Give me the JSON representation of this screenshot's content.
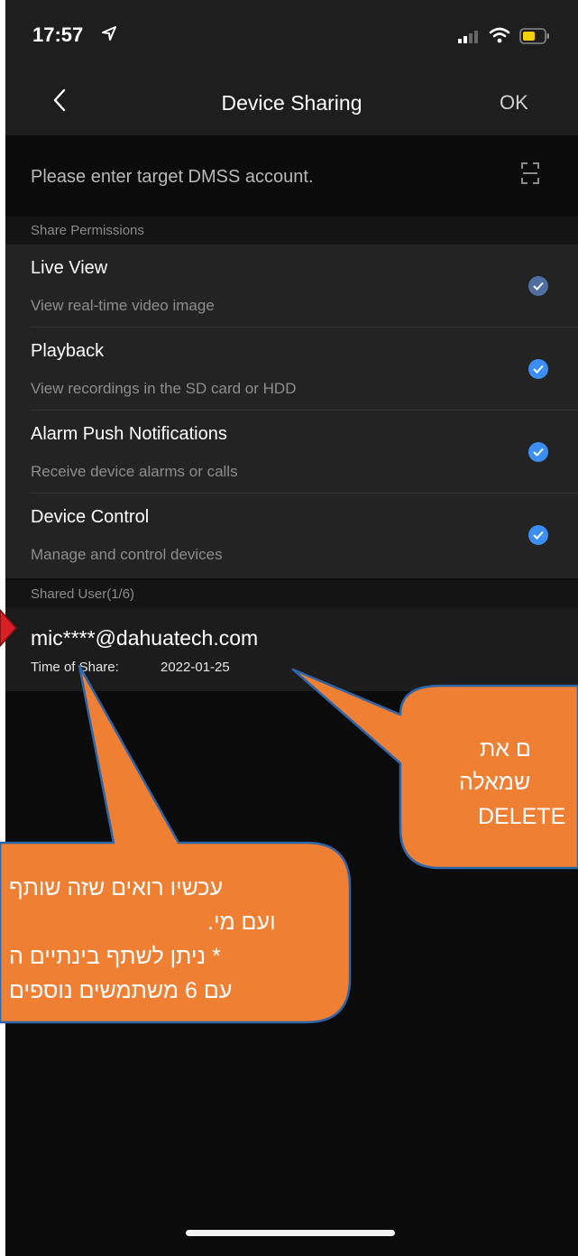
{
  "status_bar": {
    "time": "17:57",
    "icons": [
      "location-arrow-icon",
      "cellular-signal-icon",
      "wifi-icon",
      "battery-icon"
    ],
    "battery_color": "#f5d000"
  },
  "nav": {
    "back_icon": "chevron-left-icon",
    "title": "Device Sharing",
    "ok_label": "OK"
  },
  "account": {
    "placeholder": "Please enter target DMSS account.",
    "scan_icon": "scan-icon"
  },
  "permissions": {
    "header": "Share Permissions",
    "items": [
      {
        "title": "Live View",
        "description": "View real-time video image",
        "checked": true
      },
      {
        "title": "Playback",
        "description": "View recordings in the SD card or HDD",
        "checked": true
      },
      {
        "title": "Alarm Push Notifications",
        "description": "Receive device alarms or calls",
        "checked": true
      },
      {
        "title": "Device Control",
        "description": "Manage and control devices",
        "checked": true
      }
    ]
  },
  "shared_users": {
    "header": "Shared User(1/6)",
    "users": [
      {
        "email": "mic****@dahuatech.com",
        "time_label": "Time of Share:",
        "time_value": "2022-01-25"
      }
    ]
  },
  "annotations": {
    "right_callout": [
      "ם את",
      "שמאלה",
      "DELETE"
    ],
    "left_callout": [
      "עכשיו רואים שזה שותף",
      "ועם מי.",
      "* ניתן לשתף בינתיים ה",
      "עם 6 משתמשים נוספים"
    ]
  },
  "colors": {
    "accent": "#3b8ef2",
    "callout_fill": "#ee7f33",
    "callout_stroke": "#2e64a8",
    "arrow_marker": "#d81f26"
  }
}
